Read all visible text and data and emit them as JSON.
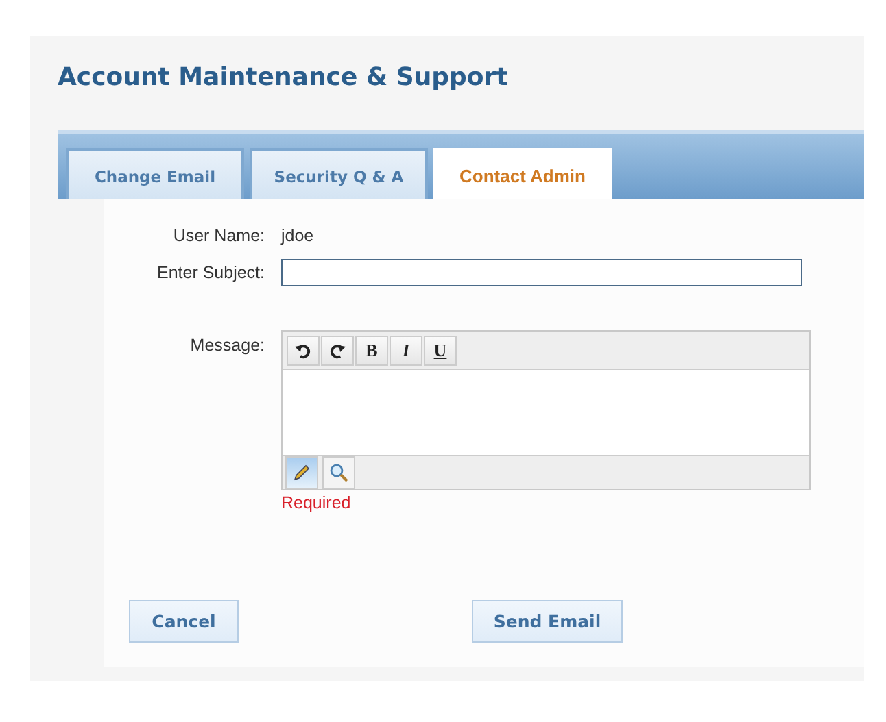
{
  "title": "Account Maintenance & Support",
  "tabs": [
    {
      "label": "Change Email",
      "selected": false
    },
    {
      "label": "Security Q & A",
      "selected": false
    },
    {
      "label": "Contact Admin",
      "selected": true
    }
  ],
  "user_name": {
    "label": "User Name:",
    "value": "jdoe"
  },
  "subject": {
    "label": "Enter Subject:"
  },
  "message": {
    "label": "Message:",
    "toolbar": [
      {
        "kind": "undo"
      },
      {
        "kind": "redo"
      },
      {
        "kind": "bold",
        "label": "B"
      },
      {
        "kind": "italic",
        "label": "I"
      },
      {
        "kind": "underline",
        "label": "U"
      }
    ],
    "modes": [
      {
        "kind": "design",
        "selected": true
      },
      {
        "kind": "preview",
        "selected": false
      }
    ],
    "validation": "Required"
  },
  "buttons": [
    "Cancel",
    "Send Email"
  ]
}
